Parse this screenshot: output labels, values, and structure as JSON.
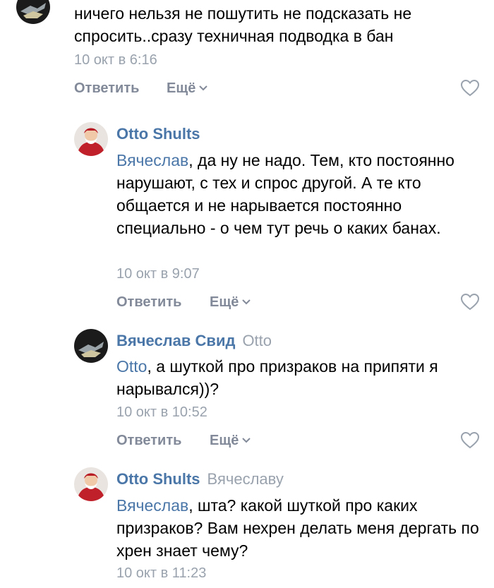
{
  "comments": [
    {
      "text": "ничего нельзя не пошутить не подсказать не спросить..сразу техничная подводка в бан",
      "date": "10 окт в 6:16",
      "reply_label": "Ответить",
      "more_label": "Ещё"
    },
    {
      "author": "Otto Shults",
      "mention": "Вячеслав",
      "text": ", да ну не надо. Тем, кто постоянно нарушают, с тех и спрос другой. А те кто общается и не нарывается постоянно специально - о чем тут речь о каких банах.",
      "date": "10 окт в 9:07",
      "reply_label": "Ответить",
      "more_label": "Ещё"
    },
    {
      "author": "Вячеслав Свид",
      "reply_to": "Otto",
      "mention": "Otto",
      "text": ", а шуткой про призраков на припяти я нарывался))?",
      "date": "10 окт в 10:52",
      "reply_label": "Ответить",
      "more_label": "Ещё"
    },
    {
      "author": "Otto Shults",
      "reply_to": "Вячеславу",
      "mention": "Вячеслав",
      "text": ", шта? какой шуткой про каких призраков? Вам нехрен делать меня дергать по хрен знает чему?",
      "date": "10 окт в 11:23"
    }
  ],
  "icons": {
    "like": "heart-outline-icon",
    "more": "chevron-down-icon"
  },
  "colors": {
    "link": "#4a76a8",
    "secondary": "#99a2ad",
    "action": "#828a99"
  }
}
